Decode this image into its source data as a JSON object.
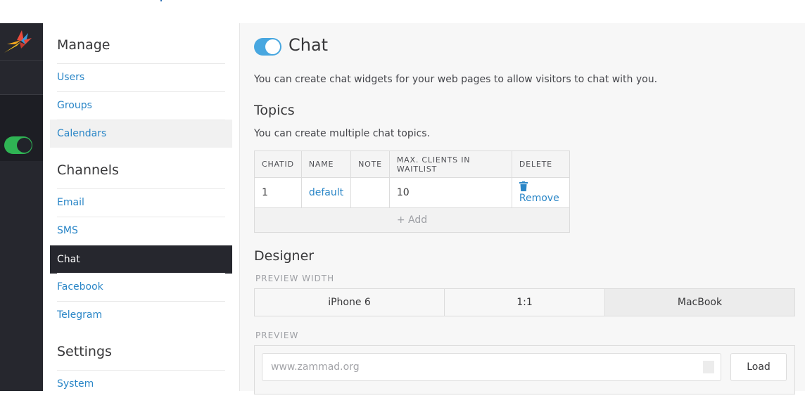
{
  "colors": {
    "rail_bg": "#26272e",
    "link": "#2a86c7",
    "active_bg": "#26272e",
    "toggle_on": "#48a7e0",
    "status_green": "#2fb454"
  },
  "rail": {
    "logo_icon": "zammad-bird-logo",
    "status_toggle": "on"
  },
  "sidebar": {
    "groups": [
      {
        "title": "Manage",
        "items": [
          {
            "label": "Users"
          },
          {
            "label": "Groups"
          },
          {
            "label": "Calendars",
            "state": "hover"
          }
        ]
      },
      {
        "title": "Channels",
        "items": [
          {
            "label": "Email"
          },
          {
            "label": "SMS"
          },
          {
            "label": "Chat",
            "state": "active"
          },
          {
            "label": "Facebook"
          },
          {
            "label": "Telegram"
          }
        ]
      },
      {
        "title": "Settings",
        "items": [
          {
            "label": "System"
          }
        ]
      }
    ]
  },
  "main": {
    "title": "Chat",
    "enabled": true,
    "description": "You can create chat widgets for your web pages to allow visitors to chat with you.",
    "topics": {
      "heading": "Topics",
      "description": "You can create multiple chat topics.",
      "columns": [
        "CHATID",
        "NAME",
        "NOTE",
        "MAX. CLIENTS IN WAITLIST",
        "DELETE"
      ],
      "rows": [
        {
          "chatid": "1",
          "name": "default",
          "note": "",
          "max_clients": "10",
          "delete_label": "Remove"
        }
      ],
      "add_label": "+ Add"
    },
    "designer": {
      "heading": "Designer",
      "preview_width_label": "PREVIEW WIDTH",
      "widths": [
        "iPhone 6",
        "1:1",
        "MacBook"
      ],
      "selected_width": "MacBook",
      "preview_label": "PREVIEW",
      "url_placeholder": "www.zammad.org",
      "url_value": "",
      "load_label": "Load"
    }
  }
}
